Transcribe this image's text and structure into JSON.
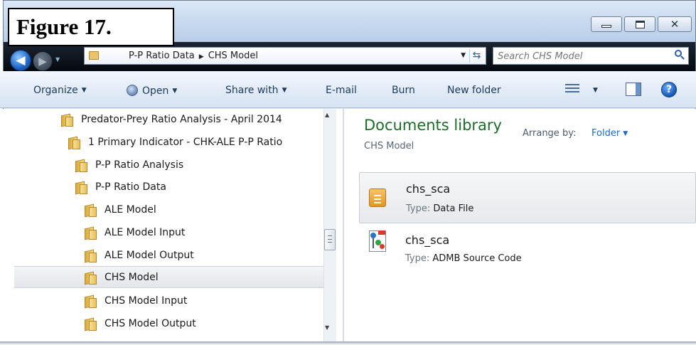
{
  "figure_label": "Figure 17.",
  "window": {
    "minimize_label": "minimize",
    "maximize_label": "maximize",
    "close_label": "close"
  },
  "address_bar": {
    "segment_1": "P-P Ratio Data",
    "segment_2": "CHS Model",
    "separator": "▶"
  },
  "search": {
    "placeholder": "Search CHS Model"
  },
  "toolbar": {
    "organize": "Organize",
    "open": "Open",
    "share_with": "Share with",
    "email": "E-mail",
    "burn": "Burn",
    "new_folder": "New folder"
  },
  "nav_tree": {
    "items": [
      {
        "label": "Predator-Prey Ratio Analysis - April 2014"
      },
      {
        "label": "1 Primary Indicator - CHK-ALE P-P Ratio"
      },
      {
        "label": "P-P Ratio Analysis"
      },
      {
        "label": "P-P Ratio Data"
      },
      {
        "label": "ALE Model"
      },
      {
        "label": "ALE Model Input"
      },
      {
        "label": "ALE Model Output"
      },
      {
        "label": "CHS Model",
        "selected": true
      },
      {
        "label": "CHS Model Input"
      },
      {
        "label": "CHS Model Output"
      }
    ]
  },
  "library": {
    "title": "Documents library",
    "subtitle": "CHS Model",
    "arrange_label": "Arrange by:",
    "arrange_value": "Folder"
  },
  "files": [
    {
      "name": "chs_sca",
      "type_key": "Type:",
      "type_value": "Data File",
      "icon": "data-file-icon",
      "selected": true
    },
    {
      "name": "chs_sca",
      "type_key": "Type:",
      "type_value": "ADMB Source Code",
      "icon": "admb-source-icon",
      "selected": false
    }
  ]
}
